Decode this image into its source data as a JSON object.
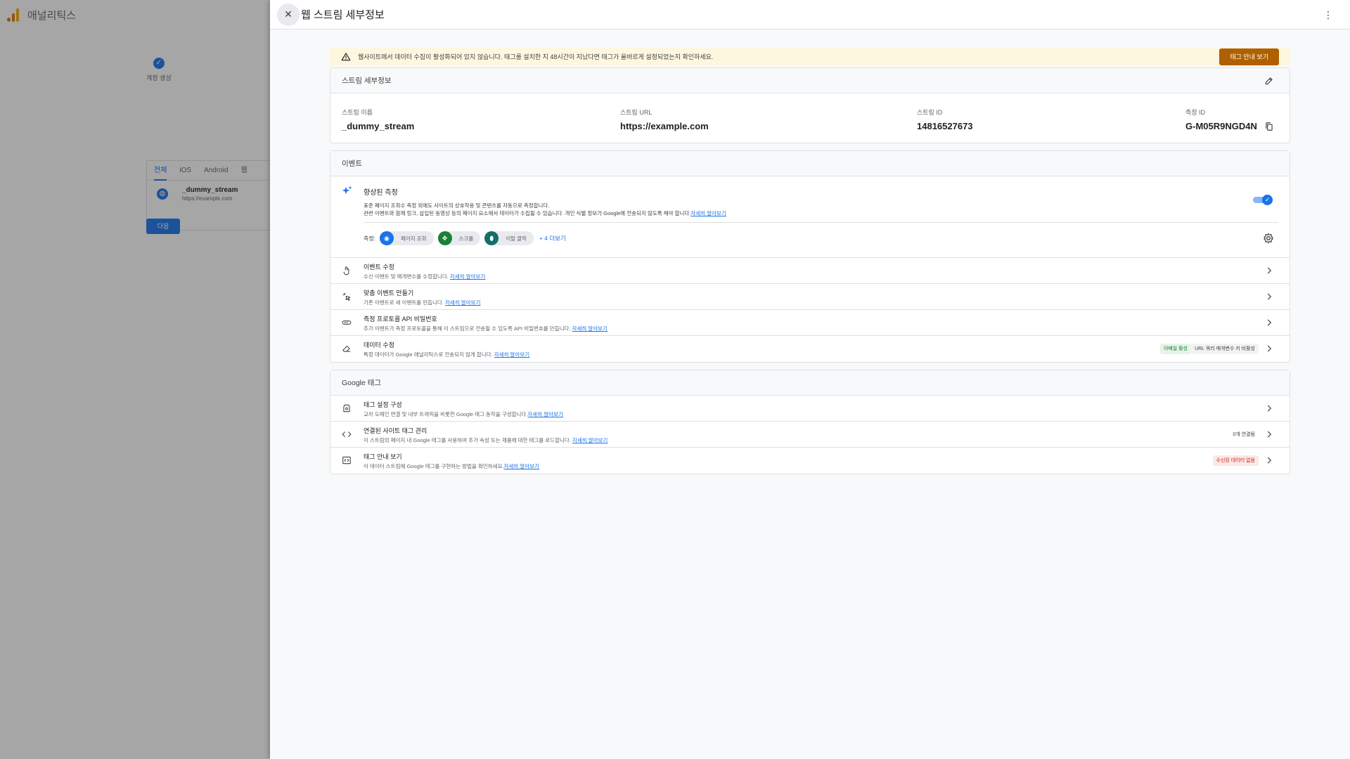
{
  "background": {
    "brand": "애널리틱스",
    "stepper_label": "계정 생성",
    "tabs": [
      "전체",
      "iOS",
      "Android",
      "웹"
    ],
    "stream_name": "_dummy_stream",
    "stream_url": "https://example.com",
    "next_button": "다음"
  },
  "drawer": {
    "title": "웹 스트림 세부정보"
  },
  "warning": {
    "text": "웹사이트에서 데이터 수집이 활성화되어 있지 않습니다. 태그를 설치한 지 48시간이 지났다면 태그가 올바르게 설정되었는지 확인하세요.",
    "button": "태그 안내 보기"
  },
  "stream_details": {
    "title": "스트림 세부정보",
    "fields": [
      {
        "label": "스트림 이름",
        "value": "_dummy_stream"
      },
      {
        "label": "스트림 URL",
        "value": "https://example.com"
      },
      {
        "label": "스트림 ID",
        "value": "14816527673"
      },
      {
        "label": "측정 ID",
        "value": "G-M05R9NGD4N"
      }
    ]
  },
  "events": {
    "title": "이벤트",
    "enhanced": {
      "title": "향상된 측정",
      "desc_line1": "표준 페이지 조회수 측정 외에도 사이트의 상호작용 및 콘텐츠를 자동으로 측정합니다.",
      "desc_line2": "관련 이벤트와 함께 링크, 삽입된 동영상 등의 페이지 요소에서 데이터가 수집될 수 있습니다. 개인 식별 정보가 Google에 전송되지 않도록 해야 합니다.",
      "learn_more": "자세히 알아보기",
      "measuring_label": "측정:",
      "chips": [
        "페이지 조회",
        "스크롤",
        "이탈 클릭"
      ],
      "more": "+ 4 더보기",
      "enabled": true
    },
    "rows": [
      {
        "title": "이벤트 수정",
        "desc": "수신 이벤트 및 매개변수를 수정합니다.",
        "link": "자세히 알아보기"
      },
      {
        "title": "맞춤 이벤트 만들기",
        "desc": "기존 이벤트로 새 이벤트를 만듭니다.",
        "link": "자세히 알아보기"
      },
      {
        "title": "측정 프로토콜 API 비밀번호",
        "desc": "추가 이벤트가 측정 프로토콜을 통해 이 스트림으로 전송될 수 있도록 API 비밀번호를 만듭니다.",
        "link": "자세히 알아보기"
      },
      {
        "title": "데이터 수정",
        "desc": "특정 데이터가 Google 애널리틱스로 전송되지 않게 합니다.",
        "link": "자세히 알아보기",
        "badge1": "이메일 활성",
        "badge2": "URL 쿼리 매개변수 키 비활성"
      }
    ]
  },
  "google_tag": {
    "title": "Google 태그",
    "rows": [
      {
        "title": "태그 설정 구성",
        "desc": "교차 도메인 연결 및 내부 트래픽을 비롯한 Google 태그 동작을 구성합니다.",
        "link": "자세히 알아보기"
      },
      {
        "title": "연결된 사이트 태그 관리",
        "desc": "이 스트림의 페이지 내 Google 태그를 사용하여 추가 속성 또는 제품에 대한 태그를 로드합니다.",
        "link": "자세히 알아보기",
        "badge": "0개 연결됨"
      },
      {
        "title": "태그 안내 보기",
        "desc": "이 데이터 스트림에 Google 태그를 구현하는 방법을 확인하세요.",
        "link": "자세히 알아보기",
        "badge": "수신된 데이터 없음"
      }
    ]
  }
}
